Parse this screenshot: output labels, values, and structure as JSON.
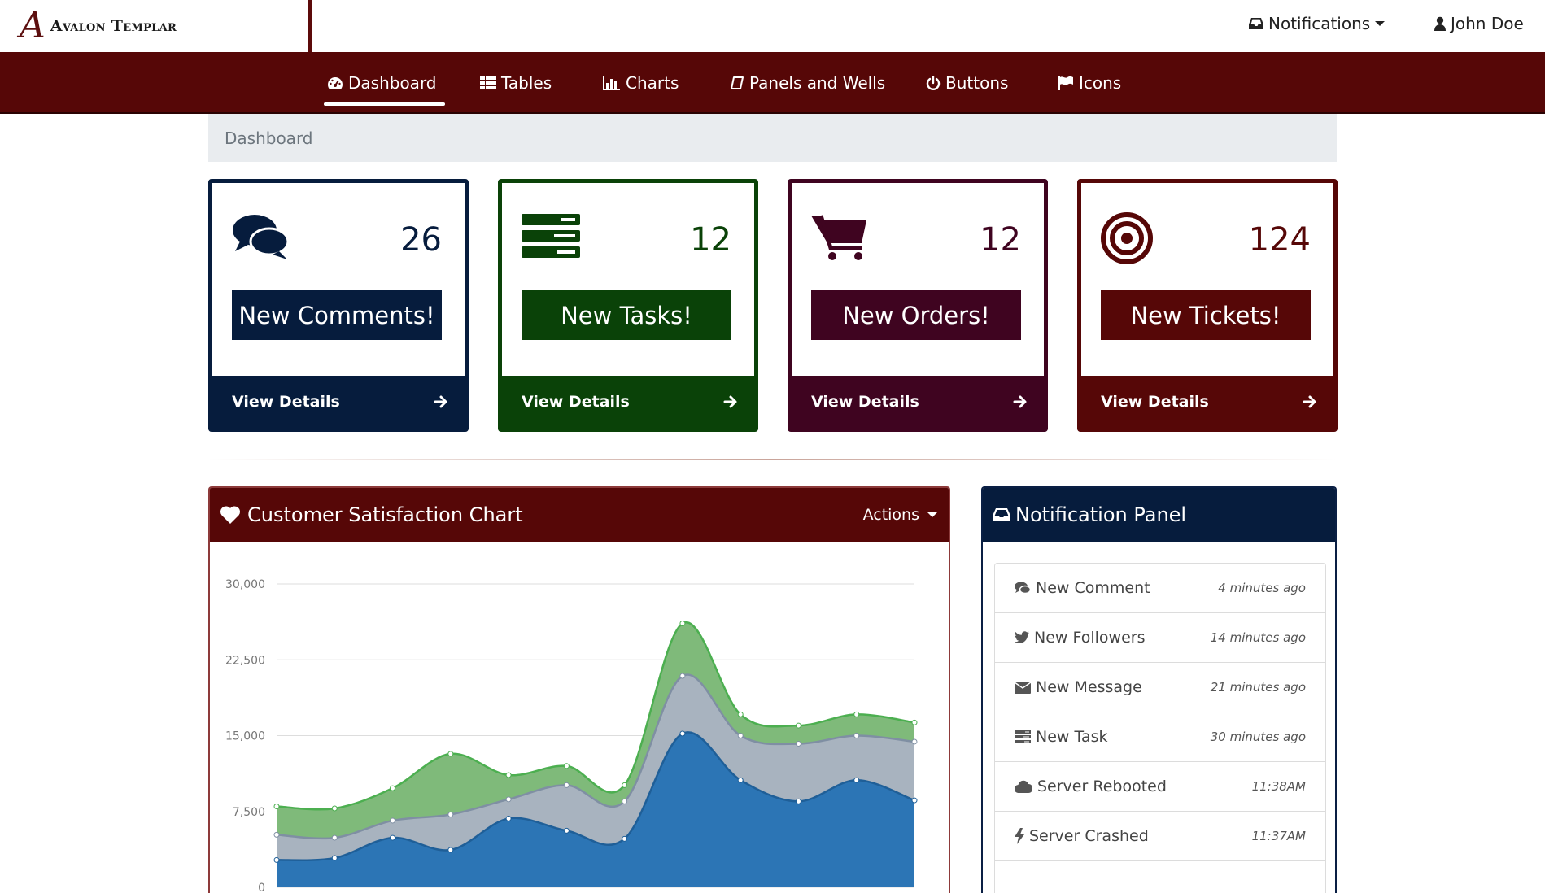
{
  "brand": {
    "mark": "A",
    "name": "Avalon Templar"
  },
  "top_right": {
    "notifications": "Notifications",
    "user": "John Doe"
  },
  "nav": [
    {
      "label": "Dashboard",
      "icon": "dashboard-icon"
    },
    {
      "label": "Tables",
      "icon": "table-icon"
    },
    {
      "label": "Charts",
      "icon": "bar-chart-icon"
    },
    {
      "label": "Panels and Wells",
      "icon": "panel-icon"
    },
    {
      "label": "Buttons",
      "icon": "power-icon"
    },
    {
      "label": "Icons",
      "icon": "flag-icon"
    }
  ],
  "breadcrumb": "Dashboard",
  "cards": [
    {
      "count": "26",
      "label": "New Comments!",
      "footer": "View Details",
      "icon": "comments-icon",
      "color": "#061c3d"
    },
    {
      "count": "12",
      "label": "New Tasks!",
      "footer": "View Details",
      "icon": "tasks-icon",
      "color": "#0a4208"
    },
    {
      "count": "12",
      "label": "New Orders!",
      "footer": "View Details",
      "icon": "shopping-cart-icon",
      "color": "#3f0420"
    },
    {
      "count": "124",
      "label": "New Tickets!",
      "footer": "View Details",
      "icon": "target-icon",
      "color": "#560707"
    }
  ],
  "chart_panel": {
    "title": "Customer Satisfaction Chart",
    "actions": "Actions"
  },
  "chart_data": {
    "type": "area",
    "stacked": true,
    "x": [
      1,
      2,
      3,
      4,
      5,
      6,
      7,
      8,
      9,
      10,
      11,
      12
    ],
    "ylim": [
      0,
      30000
    ],
    "yticks": [
      "30,000",
      "22,500",
      "15,000",
      "7,500",
      "0"
    ],
    "grid": true,
    "series": [
      {
        "values": [
          2700,
          2900,
          4900,
          3700,
          6800,
          5600,
          4800,
          15200,
          10600,
          8500,
          10600,
          8600
        ],
        "color": "#2c75b5"
      },
      {
        "values": [
          2500,
          2000,
          1700,
          3500,
          1900,
          4500,
          3700,
          5700,
          4400,
          5700,
          4400,
          5800
        ],
        "color": "#a8b3bf"
      },
      {
        "values": [
          2800,
          2900,
          3200,
          6000,
          2400,
          1900,
          1600,
          5200,
          2100,
          1800,
          2100,
          1900
        ],
        "color": "#7fba7a"
      }
    ]
  },
  "notification_panel": {
    "title": "Notification Panel",
    "items": [
      {
        "text": "New Comment",
        "time": "4 minutes ago",
        "icon": "comment-icon"
      },
      {
        "text": "New Followers",
        "time": "14 minutes ago",
        "icon": "twitter-icon"
      },
      {
        "text": "New Message",
        "time": "21 minutes ago",
        "icon": "envelope-icon"
      },
      {
        "text": "New Task",
        "time": "30 minutes ago",
        "icon": "tasks-icon"
      },
      {
        "text": "Server Rebooted",
        "time": "11:38AM",
        "icon": "cloud-icon"
      },
      {
        "text": "Server Crashed",
        "time": "11:37AM",
        "icon": "bolt-icon"
      }
    ]
  }
}
